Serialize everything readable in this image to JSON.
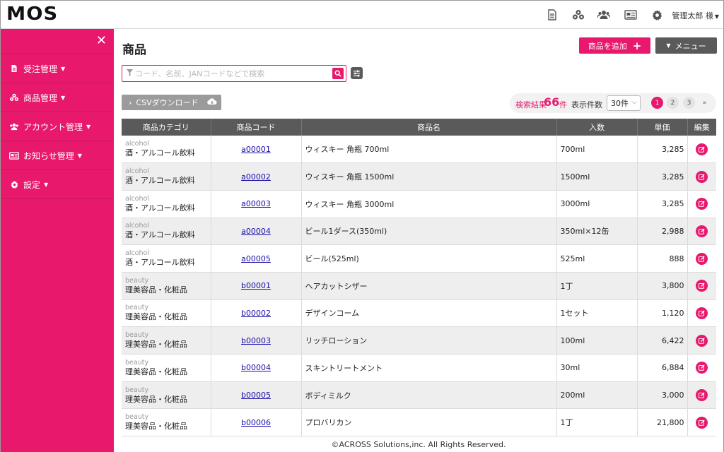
{
  "header": {
    "logo": "MOS",
    "user_name": "管理太郎 様",
    "icons": [
      "document-icon",
      "products-icon",
      "users-icon",
      "news-icon",
      "gear-icon"
    ]
  },
  "sidebar": {
    "close_icon": "close-icon",
    "items": [
      {
        "label": "受注管理",
        "icon": "document-icon"
      },
      {
        "label": "商品管理",
        "icon": "products-icon"
      },
      {
        "label": "アカウント管理",
        "icon": "users-icon"
      },
      {
        "label": "お知らせ管理",
        "icon": "news-icon"
      },
      {
        "label": "設定",
        "icon": "gear-icon"
      }
    ]
  },
  "page": {
    "title": "商品",
    "add_button": "商品を追加",
    "menu_button": "メニュー",
    "search_placeholder": "コード、名前、JANコードなどで検索",
    "search_value": "",
    "csv_button": "CSVダウンロード",
    "result_label": "検索結果",
    "result_count": "66",
    "result_unit": "件",
    "per_page_label": "表示件数",
    "per_page_value": "30件",
    "pages": [
      "1",
      "2",
      "3"
    ],
    "current_page": "1",
    "next_label": "»"
  },
  "table": {
    "headers": [
      "商品カテゴリ",
      "商品コード",
      "商品名",
      "入数",
      "単価",
      "編集"
    ],
    "rows": [
      {
        "cat_en": "alcohol",
        "cat_ja": "酒・アルコール飲料",
        "code": "a00001",
        "name": "ウィスキー 角瓶 700ml",
        "qty": "700ml",
        "price": "3,285"
      },
      {
        "cat_en": "alcohol",
        "cat_ja": "酒・アルコール飲料",
        "code": "a00002",
        "name": "ウィスキー 角瓶 1500ml",
        "qty": "1500ml",
        "price": "3,285"
      },
      {
        "cat_en": "alcohol",
        "cat_ja": "酒・アルコール飲料",
        "code": "a00003",
        "name": "ウィスキー 角瓶 3000ml",
        "qty": "3000ml",
        "price": "3,285"
      },
      {
        "cat_en": "alcohol",
        "cat_ja": "酒・アルコール飲料",
        "code": "a00004",
        "name": "ビール1ダース(350ml)",
        "qty": "350ml×12缶",
        "price": "2,988"
      },
      {
        "cat_en": "alcohol",
        "cat_ja": "酒・アルコール飲料",
        "code": "a00005",
        "name": "ビール(525ml)",
        "qty": "525ml",
        "price": "888"
      },
      {
        "cat_en": "beauty",
        "cat_ja": "理美容品・化粧品",
        "code": "b00001",
        "name": "ヘアカットシザー",
        "qty": "1丁",
        "price": "3,800"
      },
      {
        "cat_en": "beauty",
        "cat_ja": "理美容品・化粧品",
        "code": "b00002",
        "name": "デザインコーム",
        "qty": "1セット",
        "price": "1,120"
      },
      {
        "cat_en": "beauty",
        "cat_ja": "理美容品・化粧品",
        "code": "b00003",
        "name": "リッチローション",
        "qty": "100ml",
        "price": "6,422"
      },
      {
        "cat_en": "beauty",
        "cat_ja": "理美容品・化粧品",
        "code": "b00004",
        "name": "スキントリートメント",
        "qty": "30ml",
        "price": "6,884"
      },
      {
        "cat_en": "beauty",
        "cat_ja": "理美容品・化粧品",
        "code": "b00005",
        "name": "ボディミルク",
        "qty": "200ml",
        "price": "3,000"
      },
      {
        "cat_en": "beauty",
        "cat_ja": "理美容品・化粧品",
        "code": "b00006",
        "name": "プロバリカン",
        "qty": "1丁",
        "price": "21,800"
      }
    ]
  },
  "footer": {
    "copyright": "©ACROSS Solutions,inc. All Rights Reserved."
  },
  "colors": {
    "accent": "#e8196c",
    "dark": "#5a5a5a",
    "csv": "#9b9b9b"
  }
}
